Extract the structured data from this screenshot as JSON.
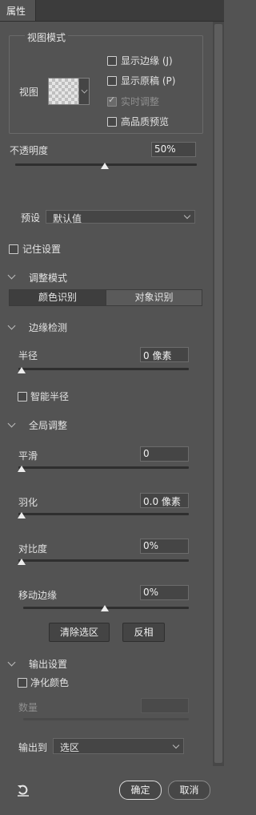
{
  "tab": {
    "label": "属性"
  },
  "view_mode": {
    "legend": "视图模式",
    "view_label": "视图",
    "show_edges": "显示边缘 (J)",
    "show_original": "显示原稿 (P)",
    "realtime": "实时调整",
    "hq_preview": "高品质预览"
  },
  "opacity": {
    "label": "不透明度",
    "value": "50%",
    "level": 0.5
  },
  "preset": {
    "label": "预设",
    "value": "默认值"
  },
  "remember": {
    "label": "记住设置"
  },
  "adjust_mode": {
    "title": "调整模式",
    "color_btn": "颜色识别",
    "object_btn": "对象识别"
  },
  "edge_detect": {
    "title": "边缘检测",
    "radius_label": "半径",
    "radius_value": "0 像素",
    "smart_radius": "智能半径"
  },
  "global": {
    "title": "全局调整",
    "smooth_label": "平滑",
    "smooth_value": "0",
    "feather_label": "羽化",
    "feather_value": "0.0 像素",
    "contrast_label": "对比度",
    "contrast_value": "0%",
    "shift_label": "移动边缘",
    "shift_value": "0%",
    "clear_btn": "清除选区",
    "invert_btn": "反相"
  },
  "output": {
    "title": "输出设置",
    "decontaminate": "净化颜色",
    "amount_label": "数量",
    "output_to_label": "输出到",
    "output_to_value": "选区"
  },
  "footer": {
    "ok": "确定",
    "cancel": "取消"
  },
  "colors": {
    "panel": "#535353",
    "input": "#454545",
    "tabbar": "#3c3c3c"
  }
}
